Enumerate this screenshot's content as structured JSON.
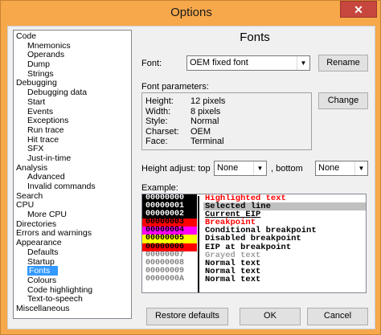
{
  "window": {
    "title": "Options",
    "close_glyph": "✕"
  },
  "tree": [
    {
      "label": "Code",
      "level": 0
    },
    {
      "label": "Mnemonics",
      "level": 1
    },
    {
      "label": "Operands",
      "level": 1
    },
    {
      "label": "Dump",
      "level": 1
    },
    {
      "label": "Strings",
      "level": 1
    },
    {
      "label": "Debugging",
      "level": 0
    },
    {
      "label": "Debugging data",
      "level": 1
    },
    {
      "label": "Start",
      "level": 1
    },
    {
      "label": "Events",
      "level": 1
    },
    {
      "label": "Exceptions",
      "level": 1
    },
    {
      "label": "Run trace",
      "level": 1
    },
    {
      "label": "Hit trace",
      "level": 1
    },
    {
      "label": "SFX",
      "level": 1
    },
    {
      "label": "Just-in-time",
      "level": 1
    },
    {
      "label": "Analysis",
      "level": 0
    },
    {
      "label": "Advanced",
      "level": 1
    },
    {
      "label": "Invalid commands",
      "level": 1
    },
    {
      "label": "Search",
      "level": 0
    },
    {
      "label": "CPU",
      "level": 0
    },
    {
      "label": "More CPU",
      "level": 1
    },
    {
      "label": "Directories",
      "level": 0
    },
    {
      "label": "Errors and warnings",
      "level": 0
    },
    {
      "label": "Appearance",
      "level": 0
    },
    {
      "label": "Defaults",
      "level": 1
    },
    {
      "label": "Startup",
      "level": 1
    },
    {
      "label": "Fonts",
      "level": 1,
      "selected": true
    },
    {
      "label": "Colours",
      "level": 1
    },
    {
      "label": "Code highlighting",
      "level": 1
    },
    {
      "label": "Text-to-speech",
      "level": 1
    },
    {
      "label": "Miscellaneous",
      "level": 0
    }
  ],
  "panel": {
    "heading": "Fonts",
    "font_label": "Font:",
    "font_value": "OEM fixed font",
    "rename_label": "Rename",
    "params_label": "Font parameters:",
    "params": [
      {
        "key": "Height:",
        "value": "12 pixels"
      },
      {
        "key": "Width:",
        "value": "8 pixels"
      },
      {
        "key": "Style:",
        "value": "Normal"
      },
      {
        "key": "Charset:",
        "value": "OEM"
      },
      {
        "key": "Face:",
        "value": "Terminal"
      }
    ],
    "change_label": "Change",
    "height_adjust_label": "Height adjust: top",
    "top_value": "None",
    "bottom_label": ", bottom",
    "bottom_value": "None",
    "example_label": "Example:",
    "restore_label": "Restore defaults",
    "ok_label": "OK",
    "cancel_label": "Cancel"
  },
  "example": {
    "codes": [
      {
        "text": "00000000",
        "fg": "#ffffff",
        "bg": "#000000"
      },
      {
        "text": "00000001",
        "fg": "#ffffff",
        "bg": "#000000"
      },
      {
        "text": "00000002",
        "fg": "#ffffff",
        "bg": "#000000"
      },
      {
        "text": "00000003",
        "fg": "#000000",
        "bg": "#ff0000"
      },
      {
        "text": "00000004",
        "fg": "#000000",
        "bg": "#ff00ff"
      },
      {
        "text": "00000005",
        "fg": "#000000",
        "bg": "#ffff00"
      },
      {
        "text": "00000006",
        "fg": "#000000",
        "bg": "#ff0000"
      },
      {
        "text": "00000007",
        "fg": "#808080",
        "bg": "#ffffff"
      },
      {
        "text": "00000008",
        "fg": "#808080",
        "bg": "#ffffff"
      },
      {
        "text": "00000009",
        "fg": "#808080",
        "bg": "#ffffff"
      },
      {
        "text": "0000000A",
        "fg": "#808080",
        "bg": "#ffffff"
      }
    ],
    "lines": [
      {
        "text": "Highlighted text",
        "fg": "#ff0000",
        "bg": "#ffffff"
      },
      {
        "text": "Selected line",
        "fg": "#000000",
        "bg": "#c0c0c0"
      },
      {
        "text": "Current EIP",
        "fg": "#000000",
        "bg": "#ffffff",
        "underline": true
      },
      {
        "text": "Breakpoint",
        "fg": "#ff0000",
        "bg": "#ffffff"
      },
      {
        "text": "Conditional breakpoint",
        "fg": "#000000",
        "bg": "#ffffff"
      },
      {
        "text": "Disabled breakpoint",
        "fg": "#000000",
        "bg": "#ffffff"
      },
      {
        "text": "EIP at breakpoint",
        "fg": "#000000",
        "bg": "#ffffff"
      },
      {
        "text": "Grayed text",
        "fg": "#a0a0a0",
        "bg": "#ffffff"
      },
      {
        "text": "Normal text",
        "fg": "#000000",
        "bg": "#ffffff"
      },
      {
        "text": "Normal text",
        "fg": "#000000",
        "bg": "#ffffff"
      },
      {
        "text": "Normal text",
        "fg": "#000000",
        "bg": "#ffffff"
      }
    ]
  }
}
